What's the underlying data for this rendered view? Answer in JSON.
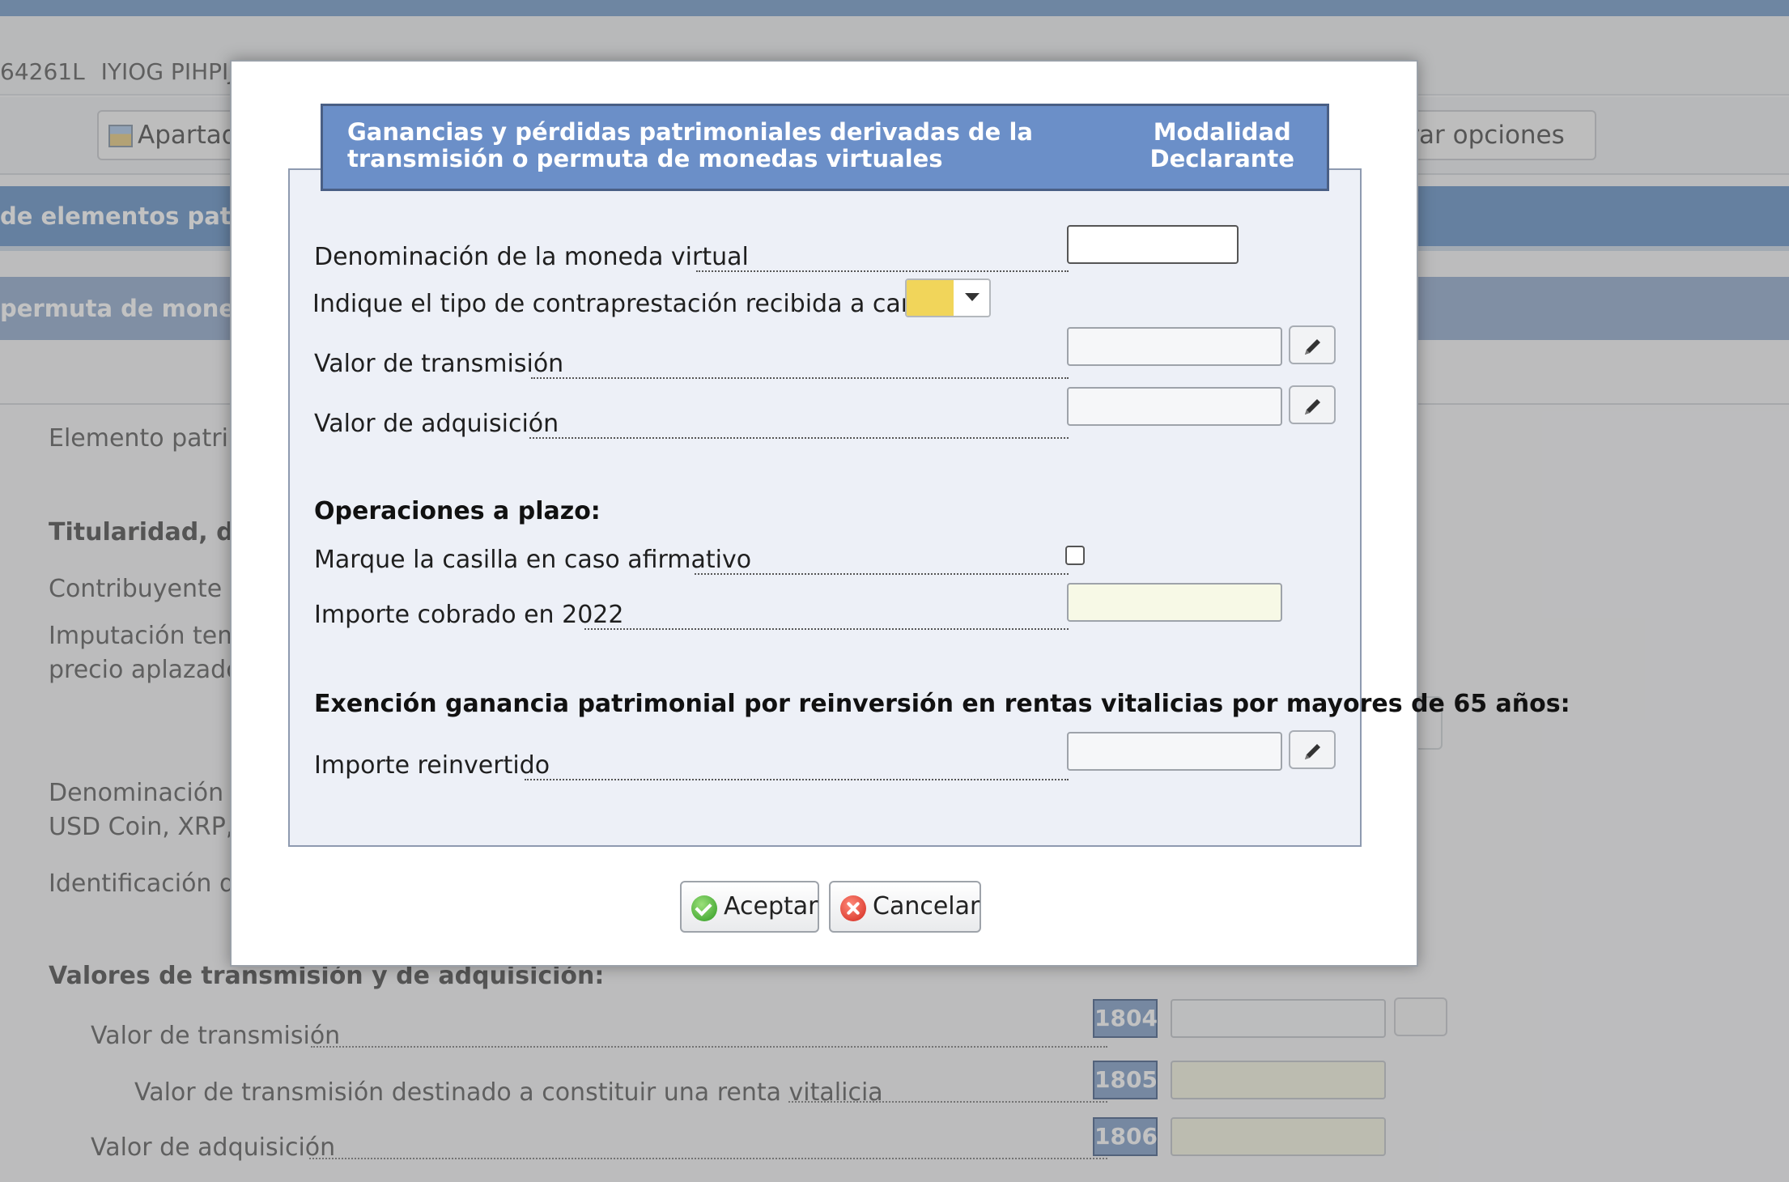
{
  "background": {
    "identity": {
      "nif": "64261L",
      "name": "IYIOG PIHPIJP"
    },
    "toolbar": {
      "apartados_label": "Apartado",
      "options_label": "strar opciones"
    },
    "section_bar_1": "de elementos patrim",
    "section_bar_2": "permuta de moneda",
    "rows": [
      {
        "text": "Elemento patrim",
        "bold": false
      },
      {
        "text": "Titularidad, dat",
        "bold": true
      },
      {
        "text": "Contribuyente tit",
        "bold": false
      },
      {
        "text": "Imputación temp",
        "bold": false
      },
      {
        "text": "precio aplazado (",
        "bold": false
      },
      {
        "text": "Denominación de",
        "bold": false
      },
      {
        "text": "USD Coin, XRP, C",
        "bold": false
      },
      {
        "text": "Identificación de",
        "bold": false
      }
    ],
    "values_heading": "Valores de transmisión y de adquisición:",
    "value_rows": [
      {
        "label": "Valor de transmisión",
        "code": "1804"
      },
      {
        "label": "Valor de transmisión destinado a constituir una renta vitalicia",
        "code": "1805"
      },
      {
        "label": "Valor de adquisición",
        "code": "1806"
      }
    ]
  },
  "dialog": {
    "title": "Ganancias y pérdidas patrimoniales derivadas de la transmisión o permuta de monedas virtuales",
    "mode_line1": "Modalidad",
    "mode_line2": "Declarante",
    "fields": {
      "virtual_currency_label": "Denominación de la moneda virtual",
      "virtual_currency_value": "",
      "consideration_type_label": "Indique el tipo de contraprestación recibida a cambio",
      "consideration_type_value": "",
      "transmission_value_label": "Valor de transmisión",
      "transmission_value": "",
      "acquisition_value_label": "Valor de adquisición",
      "acquisition_value": ""
    },
    "deferred": {
      "heading": "Operaciones a plazo:",
      "checkbox_label": "Marque la casilla en caso afirmativo",
      "checked": false,
      "amount_label": "Importe cobrado en 2022",
      "amount_value": ""
    },
    "exemption": {
      "heading": "Exención ganancia patrimonial por reinversión en rentas vitalicias por mayores de 65 años:",
      "reinvested_label": "Importe reinvertido",
      "reinvested_value": ""
    },
    "buttons": {
      "accept": "Aceptar",
      "cancel": "Cancelar"
    },
    "icons": {
      "edit": "pencil-icon",
      "accept": "check-circle-icon",
      "cancel": "x-circle-icon",
      "dropdown": "caret-down-icon"
    },
    "colors": {
      "header": "#6b8fc8",
      "select_swatch": "#f1d55a",
      "accept": "#2f9a22",
      "cancel": "#d2281d"
    }
  }
}
